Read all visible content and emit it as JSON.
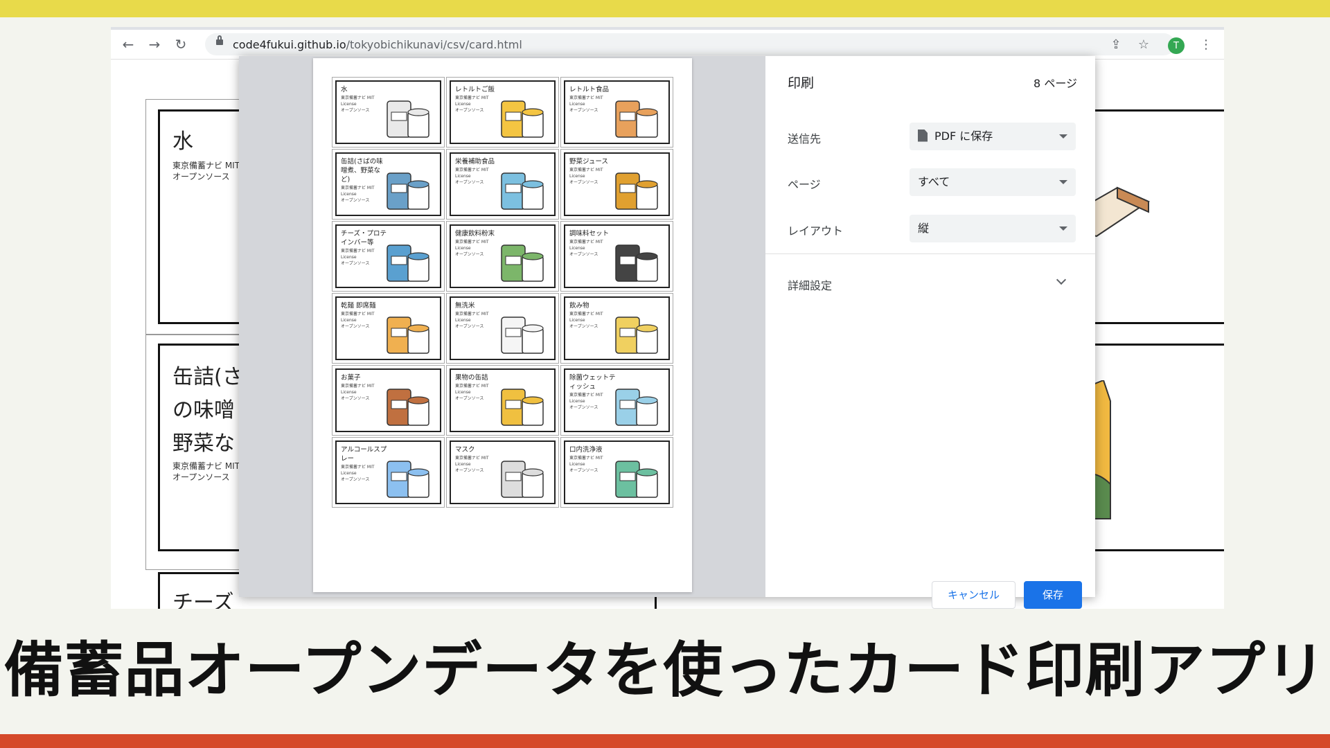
{
  "browser": {
    "url_host": "code4fukui.github.io",
    "url_path": "/tokyobichikunavi/csv/card.html",
    "avatar_letter": "T",
    "icons": [
      "back-arrow-icon",
      "forward-arrow-icon",
      "reload-icon",
      "lock-icon",
      "share-icon",
      "star-icon",
      "profile-avatar",
      "more-menu-icon"
    ]
  },
  "background_cards": [
    {
      "title": "水",
      "meta": "東京備蓄ナビ MIT\nオープンソース"
    },
    {
      "title": "缶詰(さ\nの味噌\n野菜な",
      "meta": "東京備蓄ナビ MIT\nオープンソース"
    },
    {
      "title": "チーズ",
      "meta": ""
    }
  ],
  "print_dialog": {
    "title": "印刷",
    "page_count": "8 ページ",
    "destination_label": "送信先",
    "destination_value": "PDF に保存",
    "pages_label": "ページ",
    "pages_value": "すべて",
    "layout_label": "レイアウト",
    "layout_value": "縦",
    "advanced_label": "詳細設定",
    "cancel_label": "キャンセル",
    "save_label": "保存"
  },
  "preview_cards": [
    {
      "title": "水",
      "meta": "東京備蓄ナビ MIT\nLicense\nオープンソース",
      "icon": "water-bottles"
    },
    {
      "title": "レトルトご飯",
      "meta": "東京備蓄ナビ MIT\nLicense\nオープンソース",
      "icon": "retort-rice"
    },
    {
      "title": "レトルト食品",
      "meta": "東京備蓄ナビ MIT\nLicense\nオープンソース",
      "icon": "retort-food"
    },
    {
      "title": "缶詰(さばの味噌煮、野菜など)",
      "meta": "東京備蓄ナビ MIT\nLicense\nオープンソース",
      "icon": "canned-food"
    },
    {
      "title": "栄養補助食品",
      "meta": "東京備蓄ナビ MIT\nLicense\nオープンソース",
      "icon": "nutrition-bars"
    },
    {
      "title": "野菜ジュース",
      "meta": "東京備蓄ナビ MIT\nLicense\nオープンソース",
      "icon": "vegetable-juice"
    },
    {
      "title": "チーズ・プロテインバー等",
      "meta": "東京備蓄ナビ MIT\nLicense\nオープンソース",
      "icon": "cheese-protein"
    },
    {
      "title": "健康飲料粉末",
      "meta": "東京備蓄ナビ MIT\nLicense\nオープンソース",
      "icon": "drink-powder"
    },
    {
      "title": "調味料セット",
      "meta": "東京備蓄ナビ MIT\nLicense\nオープンソース",
      "icon": "seasoning-set"
    },
    {
      "title": "乾麺 即席麺",
      "meta": "東京備蓄ナビ MIT\nLicense\nオープンソース",
      "icon": "noodles"
    },
    {
      "title": "無洗米",
      "meta": "東京備蓄ナビ MIT\nLicense\nオープンソース",
      "icon": "rice-bag"
    },
    {
      "title": "飲み物",
      "meta": "東京備蓄ナビ MIT\nLicense\nオープンソース",
      "icon": "drinks"
    },
    {
      "title": "お菓子",
      "meta": "東京備蓄ナビ MIT\nLicense\nオープンソース",
      "icon": "snacks"
    },
    {
      "title": "果物の缶詰",
      "meta": "東京備蓄ナビ MIT\nLicense\nオープンソース",
      "icon": "fruit-cans"
    },
    {
      "title": "除菌ウェットティッシュ",
      "meta": "東京備蓄ナビ MIT\nLicense\nオープンソース",
      "icon": "wet-tissue"
    },
    {
      "title": "アルコールスプレー",
      "meta": "東京備蓄ナビ MIT\nLicense\nオープンソース",
      "icon": "alcohol-spray"
    },
    {
      "title": "マスク",
      "meta": "東京備蓄ナビ MIT\nLicense\nオープンソース",
      "icon": "mask"
    },
    {
      "title": "口内洗浄液",
      "meta": "東京備蓄ナビ MIT\nLicense\nオープンソース",
      "icon": "mouthwash"
    }
  ],
  "caption": "備蓄品オープンデータを使ったカード印刷アプリ",
  "colors": {
    "top_band": "#e8da4a",
    "bottom_band": "#d5492a",
    "accent": "#1a73e8"
  }
}
